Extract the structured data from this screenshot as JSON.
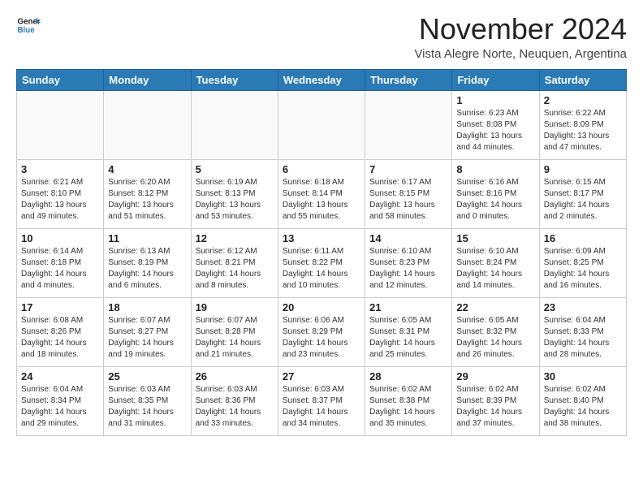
{
  "header": {
    "logo_line1": "General",
    "logo_line2": "Blue",
    "month": "November 2024",
    "location": "Vista Alegre Norte, Neuquen, Argentina"
  },
  "weekdays": [
    "Sunday",
    "Monday",
    "Tuesday",
    "Wednesday",
    "Thursday",
    "Friday",
    "Saturday"
  ],
  "weeks": [
    [
      {
        "day": "",
        "info": ""
      },
      {
        "day": "",
        "info": ""
      },
      {
        "day": "",
        "info": ""
      },
      {
        "day": "",
        "info": ""
      },
      {
        "day": "",
        "info": ""
      },
      {
        "day": "1",
        "info": "Sunrise: 6:23 AM\nSunset: 8:08 PM\nDaylight: 13 hours\nand 44 minutes."
      },
      {
        "day": "2",
        "info": "Sunrise: 6:22 AM\nSunset: 8:09 PM\nDaylight: 13 hours\nand 47 minutes."
      }
    ],
    [
      {
        "day": "3",
        "info": "Sunrise: 6:21 AM\nSunset: 8:10 PM\nDaylight: 13 hours\nand 49 minutes."
      },
      {
        "day": "4",
        "info": "Sunrise: 6:20 AM\nSunset: 8:12 PM\nDaylight: 13 hours\nand 51 minutes."
      },
      {
        "day": "5",
        "info": "Sunrise: 6:19 AM\nSunset: 8:13 PM\nDaylight: 13 hours\nand 53 minutes."
      },
      {
        "day": "6",
        "info": "Sunrise: 6:18 AM\nSunset: 8:14 PM\nDaylight: 13 hours\nand 55 minutes."
      },
      {
        "day": "7",
        "info": "Sunrise: 6:17 AM\nSunset: 8:15 PM\nDaylight: 13 hours\nand 58 minutes."
      },
      {
        "day": "8",
        "info": "Sunrise: 6:16 AM\nSunset: 8:16 PM\nDaylight: 14 hours\nand 0 minutes."
      },
      {
        "day": "9",
        "info": "Sunrise: 6:15 AM\nSunset: 8:17 PM\nDaylight: 14 hours\nand 2 minutes."
      }
    ],
    [
      {
        "day": "10",
        "info": "Sunrise: 6:14 AM\nSunset: 8:18 PM\nDaylight: 14 hours\nand 4 minutes."
      },
      {
        "day": "11",
        "info": "Sunrise: 6:13 AM\nSunset: 8:19 PM\nDaylight: 14 hours\nand 6 minutes."
      },
      {
        "day": "12",
        "info": "Sunrise: 6:12 AM\nSunset: 8:21 PM\nDaylight: 14 hours\nand 8 minutes."
      },
      {
        "day": "13",
        "info": "Sunrise: 6:11 AM\nSunset: 8:22 PM\nDaylight: 14 hours\nand 10 minutes."
      },
      {
        "day": "14",
        "info": "Sunrise: 6:10 AM\nSunset: 8:23 PM\nDaylight: 14 hours\nand 12 minutes."
      },
      {
        "day": "15",
        "info": "Sunrise: 6:10 AM\nSunset: 8:24 PM\nDaylight: 14 hours\nand 14 minutes."
      },
      {
        "day": "16",
        "info": "Sunrise: 6:09 AM\nSunset: 8:25 PM\nDaylight: 14 hours\nand 16 minutes."
      }
    ],
    [
      {
        "day": "17",
        "info": "Sunrise: 6:08 AM\nSunset: 8:26 PM\nDaylight: 14 hours\nand 18 minutes."
      },
      {
        "day": "18",
        "info": "Sunrise: 6:07 AM\nSunset: 8:27 PM\nDaylight: 14 hours\nand 19 minutes."
      },
      {
        "day": "19",
        "info": "Sunrise: 6:07 AM\nSunset: 8:28 PM\nDaylight: 14 hours\nand 21 minutes."
      },
      {
        "day": "20",
        "info": "Sunrise: 6:06 AM\nSunset: 8:29 PM\nDaylight: 14 hours\nand 23 minutes."
      },
      {
        "day": "21",
        "info": "Sunrise: 6:05 AM\nSunset: 8:31 PM\nDaylight: 14 hours\nand 25 minutes."
      },
      {
        "day": "22",
        "info": "Sunrise: 6:05 AM\nSunset: 8:32 PM\nDaylight: 14 hours\nand 26 minutes."
      },
      {
        "day": "23",
        "info": "Sunrise: 6:04 AM\nSunset: 8:33 PM\nDaylight: 14 hours\nand 28 minutes."
      }
    ],
    [
      {
        "day": "24",
        "info": "Sunrise: 6:04 AM\nSunset: 8:34 PM\nDaylight: 14 hours\nand 29 minutes."
      },
      {
        "day": "25",
        "info": "Sunrise: 6:03 AM\nSunset: 8:35 PM\nDaylight: 14 hours\nand 31 minutes."
      },
      {
        "day": "26",
        "info": "Sunrise: 6:03 AM\nSunset: 8:36 PM\nDaylight: 14 hours\nand 33 minutes."
      },
      {
        "day": "27",
        "info": "Sunrise: 6:03 AM\nSunset: 8:37 PM\nDaylight: 14 hours\nand 34 minutes."
      },
      {
        "day": "28",
        "info": "Sunrise: 6:02 AM\nSunset: 8:38 PM\nDaylight: 14 hours\nand 35 minutes."
      },
      {
        "day": "29",
        "info": "Sunrise: 6:02 AM\nSunset: 8:39 PM\nDaylight: 14 hours\nand 37 minutes."
      },
      {
        "day": "30",
        "info": "Sunrise: 6:02 AM\nSunset: 8:40 PM\nDaylight: 14 hours\nand 38 minutes."
      }
    ]
  ]
}
